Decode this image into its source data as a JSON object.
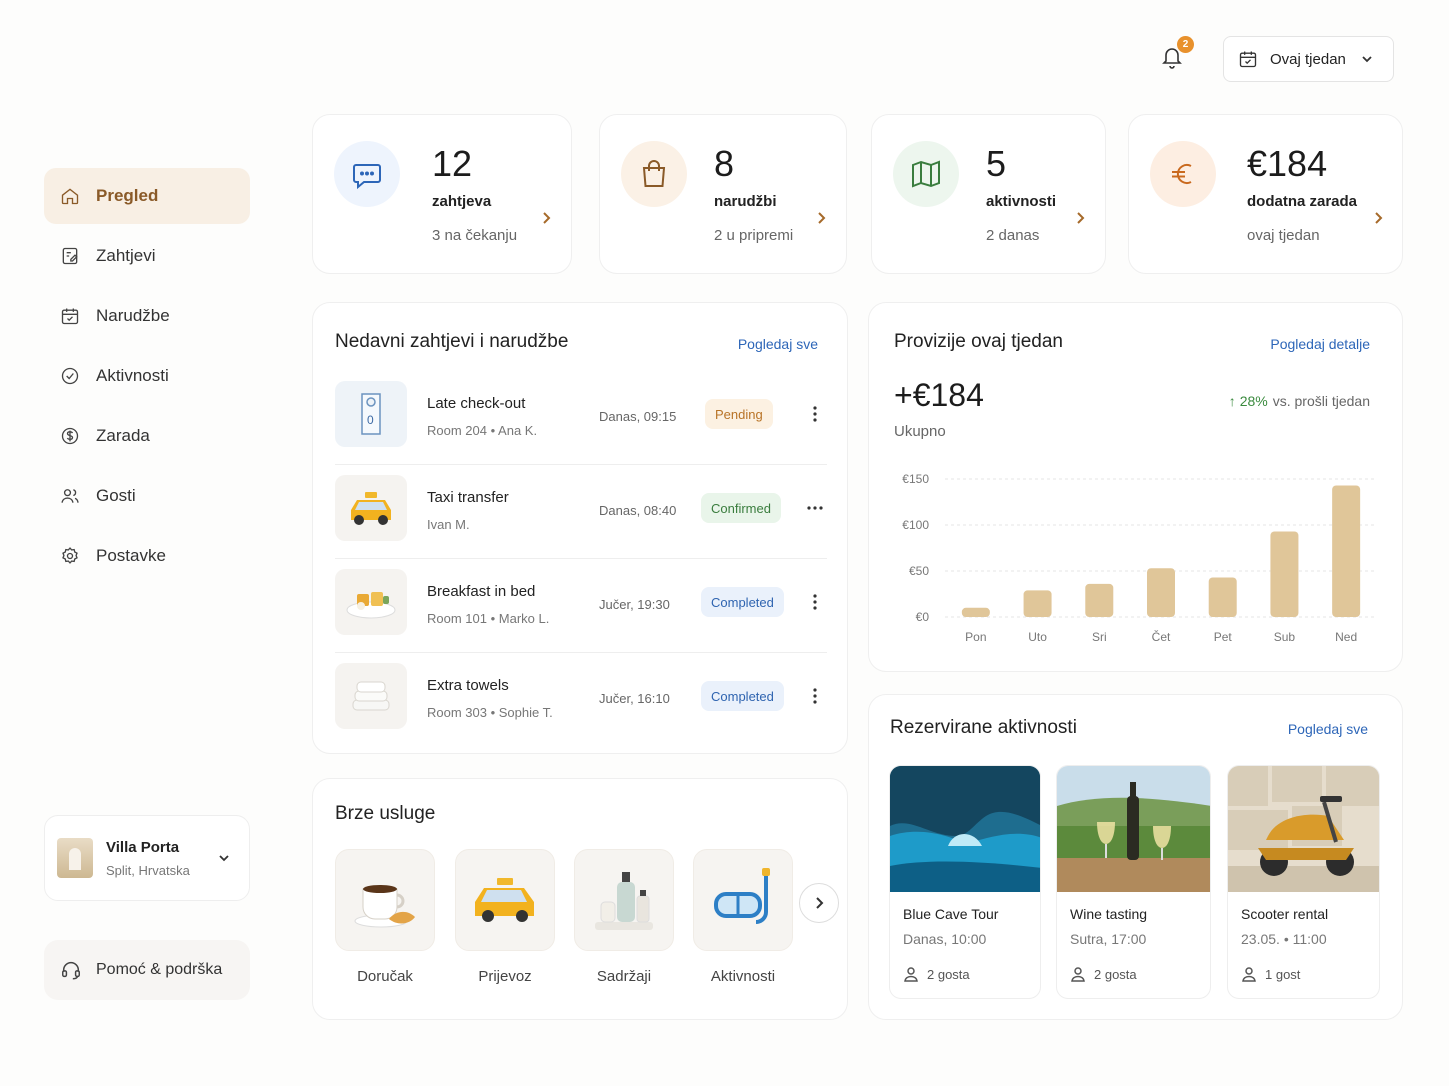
{
  "sidebar": {
    "items": [
      {
        "label": "Pregled",
        "icon": "home-icon",
        "active": true
      },
      {
        "label": "Zahtjevi",
        "icon": "requests-icon"
      },
      {
        "label": "Narudžbe",
        "icon": "calendar-icon"
      },
      {
        "label": "Aktivnosti",
        "icon": "compass-icon"
      },
      {
        "label": "Zarada",
        "icon": "dollar-icon"
      },
      {
        "label": "Gosti",
        "icon": "users-icon"
      },
      {
        "label": "Postavke",
        "icon": "gear-icon"
      }
    ],
    "property": {
      "name": "Villa Porta",
      "location": "Split, Hrvatska"
    },
    "support": "Pomoć & podrška"
  },
  "header": {
    "notifications_count": "2",
    "period": "Ovaj tjedan"
  },
  "stats": [
    {
      "value": "12",
      "label": "zahtjeva",
      "sub": "3 na čekanju",
      "icon": "chat-icon",
      "color": "#eef4fd"
    },
    {
      "value": "8",
      "label": "narudžbi",
      "sub": "2 u pripremi",
      "icon": "bag-icon",
      "color": "#fbf1e6"
    },
    {
      "value": "5",
      "label": "aktivnosti",
      "sub": "2 danas",
      "icon": "map-icon",
      "color": "#edf6ee"
    },
    {
      "value": "€184",
      "label": "dodatna zarada",
      "sub": "ovaj tjedan",
      "icon": "euro-icon",
      "color": "#fdeee2"
    }
  ],
  "recent": {
    "title": "Nedavni zahtjevi i narudžbe",
    "link": "Pogledaj sve",
    "rows": [
      {
        "title": "Late check-out",
        "sub": "Room 204  •  Ana K.",
        "time": "Danas, 09:15",
        "status": "Pending"
      },
      {
        "title": "Taxi transfer",
        "sub": "Ivan M.",
        "time": "Danas, 08:40",
        "status": "Confirmed"
      },
      {
        "title": "Breakfast in bed",
        "sub": "Room 101  •  Marko L.",
        "time": "Jučer, 19:30",
        "status": "Completed"
      },
      {
        "title": "Extra towels",
        "sub": "Room 303  •  Sophie T.",
        "time": "Jučer, 16:10",
        "status": "Completed"
      }
    ]
  },
  "quick": {
    "title": "Brze usluge",
    "items": [
      {
        "label": "Doručak"
      },
      {
        "label": "Prijevoz"
      },
      {
        "label": "Sadržaji"
      },
      {
        "label": "Aktivnosti"
      }
    ]
  },
  "commission": {
    "title": "Provizije ovaj tjedan",
    "link": "Pogledaj detalje",
    "total": "+€184",
    "total_label": "Ukupno",
    "trend_pct": "28%",
    "trend_text": "vs. prošli tjedan"
  },
  "chart_data": {
    "type": "bar",
    "categories": [
      "Pon",
      "Uto",
      "Sri",
      "Čet",
      "Pet",
      "Sub",
      "Ned"
    ],
    "values": [
      10,
      29,
      36,
      53,
      43,
      93,
      143
    ],
    "y_ticks": [
      "€0",
      "€50",
      "€100",
      "€150"
    ],
    "ylim": [
      0,
      150
    ],
    "grid": true,
    "color": "#e0c699"
  },
  "activities": {
    "title": "Rezervirane aktivnosti",
    "link": "Pogledaj sve",
    "items": [
      {
        "title": "Blue Cave Tour",
        "when": "Danas, 10:00",
        "guests": "2 gosta"
      },
      {
        "title": "Wine tasting",
        "when": "Sutra, 17:00",
        "guests": "2 gosta"
      },
      {
        "title": "Scooter rental",
        "when": "23.05. • 11:00",
        "guests": "1 gost"
      }
    ]
  }
}
